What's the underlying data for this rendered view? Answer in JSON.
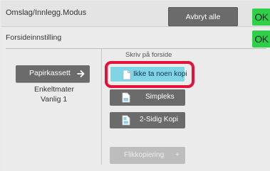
{
  "header": {
    "title": "Omslag/Innlegg.Modus",
    "cancel_all_label": "Avbryt alle",
    "ok_label": "OK"
  },
  "panel": {
    "title": "Forsideinnstilling",
    "ok_label": "OK",
    "paper_tray": {
      "button_label": "Papirkassett",
      "line1": "Enkeltmater",
      "line2": "Vanlig 1"
    },
    "print_cover": {
      "label": "Skriv på forside",
      "options": [
        {
          "label": "Ikke ta noen kopi",
          "selected": true
        },
        {
          "label": "Simpleks",
          "selected": false
        },
        {
          "label": "2-Sidig Kopi",
          "selected": false
        }
      ]
    },
    "flick_copy": {
      "label": "Flikkopiering",
      "enabled": false
    }
  },
  "colors": {
    "ok_green": "#2fd047",
    "button_gray": "#6b6b6b",
    "selected_cyan": "#7fd4e6",
    "highlight_red": "#e2123a",
    "disabled_gray": "#bdbdbd"
  }
}
